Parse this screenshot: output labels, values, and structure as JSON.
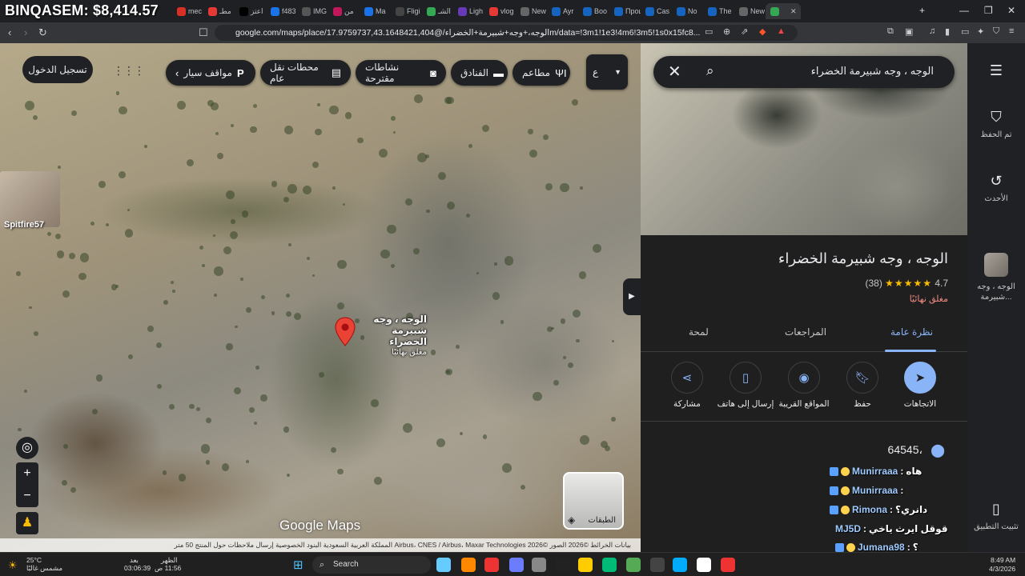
{
  "browser": {
    "overlay_balance": "BINQASEM: $8,414.57",
    "tabs": [
      "mec",
      "مطـ",
      "اعتز",
      "f483",
      "IMG",
      "من",
      "Ma",
      "Fligi",
      "الشـ",
      "Ligh",
      "vlog",
      "New",
      "Ayr",
      "Boo",
      "Проц",
      "Cas",
      "No",
      "The",
      "New",
      ""
    ],
    "url": "google.com/maps/place/الوجه،+وجه+شبيرمة+الخضراء/@17.9759737,43.1648421,404m/data=!3m1!1e3!4m6!3m5!1s0x15fc8..."
  },
  "map": {
    "login_label": "تسجيل الدخول",
    "chips": [
      {
        "label": "مطاعم",
        "icon": "restaurant-icon"
      },
      {
        "label": "الفنادق",
        "icon": "hotel-icon"
      },
      {
        "label": "نشاطات مقترحة",
        "icon": "camera-icon"
      },
      {
        "label": "محطات نقل عام",
        "icon": "transit-icon"
      },
      {
        "label": "مواقف سيار",
        "icon": "parking-icon"
      }
    ],
    "dropdown_label": "ع",
    "pin_title": "الوجه ، وجه شبيرمة الخضراء",
    "pin_status": "مغلق نهائيًا",
    "streamer_name": "Spitfire57",
    "layers_label": "الطبقات",
    "brand": "Google Maps",
    "footer": "بيانات الخرائط ©2026 الصور ©2026 Airbus، CNES / Airbus، Maxar Technologies   المملكة العربية السعودية   البنود   الخصوصية   إرسال ملاحظات حول المنتج   50 متر"
  },
  "search": {
    "query": "الوجه ، وجه شبيرمة الخضراء"
  },
  "place": {
    "title": "الوجه ، وجه شبيرمة الخضراء",
    "rating": "4.7",
    "stars": "★★★★★",
    "reviews": "(38)",
    "status": "مغلق نهائيًا",
    "tabs": [
      "نظرة عامة",
      "المراجعات",
      "لمحة"
    ],
    "actions": [
      "الاتجاهات",
      "حفظ",
      "المواقع القريبة",
      "إرسال إلى هاتف",
      "مشاركة"
    ],
    "address": "64545،"
  },
  "rail": {
    "saved": "تم الحفظ",
    "recent": "الأحدث",
    "recent_place": "الوجه ، وجه شبيرمة...",
    "install": "تثبيت التطبيق"
  },
  "chat": [
    {
      "user": "Munirraaa",
      "msg": "هاه"
    },
    {
      "user": "Munirraaa",
      "msg": ""
    },
    {
      "user": "Rimona",
      "msg": "دانري؟"
    },
    {
      "user": "MJ5D",
      "msg": "قوقل ايرث ياخي"
    },
    {
      "user": "Jumana98",
      "msg": "؟"
    },
    {
      "user": "Munirraaa",
      "msg": ""
    }
  ],
  "taskbar": {
    "weather_temp": "25°C",
    "weather_desc": "مشمس غالبًا",
    "prayer_label": "بعد",
    "prayer_name": "الظهر",
    "prayer_countdown": "03:06:39",
    "prayer_time": "11:56 ص",
    "search_label": "Search",
    "time": "8:49 AM",
    "date": "4/3/2026"
  }
}
